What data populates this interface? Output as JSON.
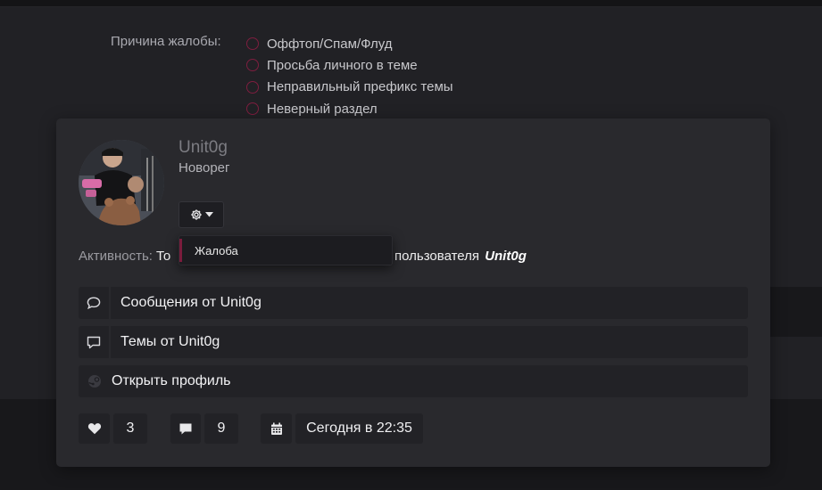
{
  "report_form": {
    "reason_label": "Причина жалобы:",
    "reasons": [
      "Оффтоп/Спам/Флуд",
      "Просьба личного в теме",
      "Неправильный префикс темы",
      "Неверный раздел"
    ]
  },
  "profile_card": {
    "username": "Unit0g",
    "user_title": "Новорег",
    "activity_label": "Активность:",
    "activity_value_prefix": "То",
    "activity_value_suffix": "ль пользователя",
    "activity_user": "Unit0g",
    "dropdown": {
      "report_label": "Жалоба"
    },
    "links": {
      "messages": "Сообщения от Unit0g",
      "threads": "Темы от Unit0g",
      "open_profile": "Открыть профиль"
    },
    "stats": {
      "likes": "3",
      "messages": "9",
      "last_seen": "Сегодня в 22:35"
    },
    "icons": {
      "gear": "gear-icon",
      "caret": "caret-down-icon",
      "messages": "speech-bubble-icon",
      "threads": "comment-icon",
      "profile": "steam-icon",
      "likes": "heart-icon",
      "comments": "comment-filled-icon",
      "calendar": "calendar-icon"
    }
  },
  "colors": {
    "accent": "#7a1c3c",
    "card_bg": "#29292d",
    "row_bg": "#222226"
  }
}
